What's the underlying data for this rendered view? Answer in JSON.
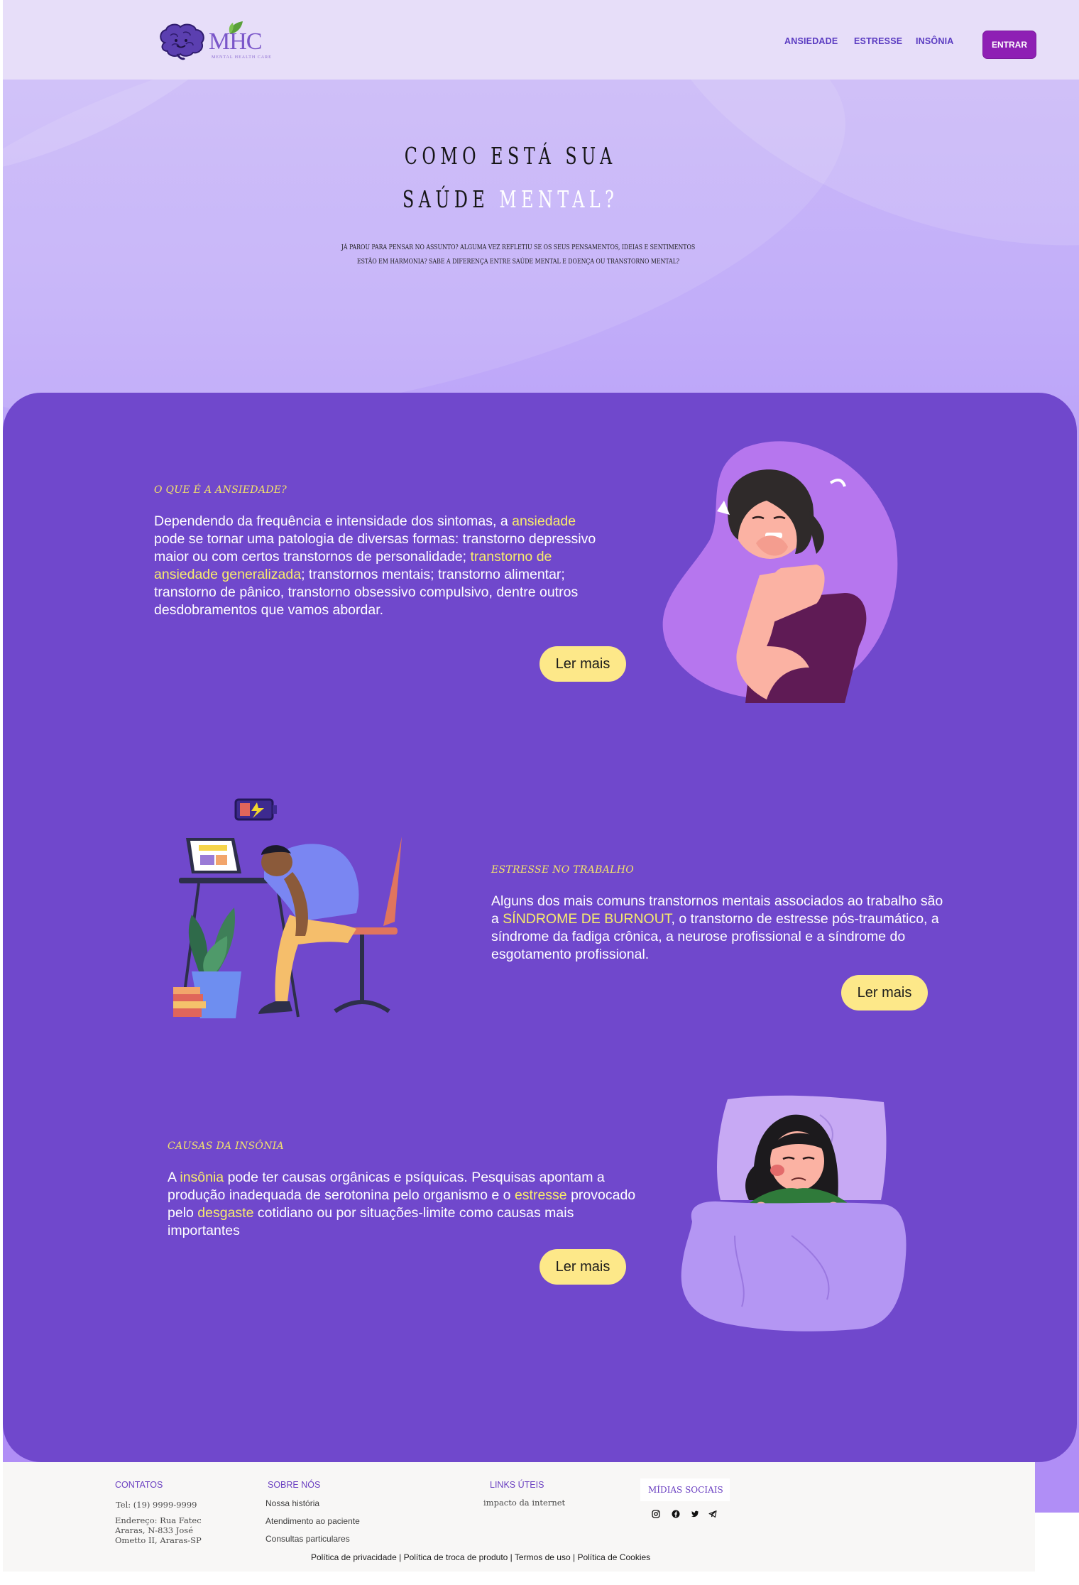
{
  "header": {
    "logo_text": "MHC",
    "logo_subtitle": "MENTAL HEALTH CARE",
    "nav": [
      "ANSIEDADE",
      "ESTRESSE",
      "INSÔNIA"
    ],
    "login_label": "ENTRAR"
  },
  "hero": {
    "title_line1": "COMO ESTÁ SUA",
    "title_line2_part1": "SAÚDE",
    "title_line2_part2": "MENTAL?",
    "subtitle_line1": "JÁ PAROU PARA PENSAR NO ASSUNTO? ALGUMA VEZ REFLETIU SE OS SEUS PENSAMENTOS, IDEIAS E SENTIMENTOS",
    "subtitle_line2": "ESTÃO EM HARMONIA? SABE A DIFERENÇA ENTRE SAÚDE MENTAL E DOENÇA OU TRANSTORNO MENTAL?"
  },
  "sections": {
    "anxiety": {
      "title": "O QUE É A ANSIEDADE?",
      "t1": "Dependendo da frequência e intensidade dos sintomas, a ",
      "h1": "ansiedade",
      "t2": "pode se tornar uma patologia de diversas formas: transtorno depressivo maior ou com certos transtornos de personalidade; ",
      "h2": "transtorno de ansiedade generalizada",
      "t3": "; transtornos mentais; transtorno alimentar; transtorno de pânico, transtorno obsessivo compulsivo, dentre outros desdobramentos que vamos abordar.",
      "button": "Ler mais"
    },
    "stress": {
      "title": "ESTRESSE NO TRABALHO",
      "t1": "Alguns dos mais comuns transtornos mentais associados ao trabalho são a ",
      "h1": "SÍNDROME DE BURNOUT",
      "t2": ", o transtorno de estresse pós-traumático, a síndrome da fadiga crônica, a neurose profissional e a síndrome do esgotamento profissional.",
      "button": "Ler mais"
    },
    "insomnia": {
      "title": "CAUSAS DA INSÔNIA",
      "t1": "A ",
      "h1": "insônia",
      "t2": " pode ter causas orgânicas e psíquicas. Pesquisas apontam a produção inadequada de serotonina pelo organismo e o ",
      "h2": "estresse",
      "t3": " provocado pelo ",
      "h3": "desgaste",
      "t4": " cotidiano ou por situações-limite como causas mais importantes",
      "button": "Ler mais"
    }
  },
  "footer": {
    "contacts_heading": "CONTATOS",
    "phone": "Tel:  (19) 9999-9999",
    "address_line1": "Endereço: Rua Fatec",
    "address_line2": "Araras, N-833 José",
    "address_line3": "Ometto II, Araras-SP",
    "about_heading": "SOBRE NÓS",
    "about_items": [
      "Nossa história",
      "Atendimento ao paciente",
      "Consultas particulares"
    ],
    "links_heading": "LINKS ÚTEIS",
    "links_items": [
      "impacto da internet"
    ],
    "social_heading": "MÍDIAS SOCIAIS",
    "social_icons": [
      "instagram-icon",
      "facebook-icon",
      "twitter-icon",
      "telegram-icon"
    ],
    "legal": [
      "Política de privacidade",
      "Política de troca  de produto",
      "Termos de uso",
      "Política de Cookies"
    ]
  }
}
